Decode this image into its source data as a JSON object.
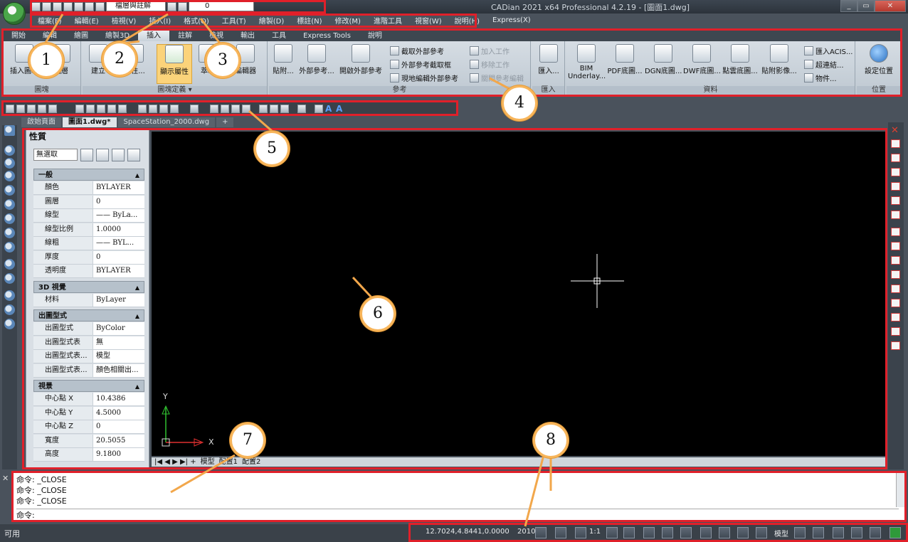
{
  "window": {
    "title": "CADian 2021 x64 Professional 4.2.19 - [圖面1.dwg]",
    "minimize": "_",
    "restore": "▭",
    "close": "✕"
  },
  "qat": {
    "layer_combo": "檔層與註解",
    "layer_value": "0"
  },
  "menu": [
    "檔案(F)",
    "編輯(E)",
    "檢視(V)",
    "插入(I)",
    "格式(O)",
    "工具(T)",
    "繪製(D)",
    "標註(N)",
    "修改(M)",
    "進階工具",
    "視窗(W)",
    "說明(H)",
    "Express(X)"
  ],
  "ribbon_tabs": [
    "開始",
    "編輯",
    "繪圖",
    "繪製3D",
    "插入",
    "註解",
    "檢視",
    "輸出",
    "工具",
    "Express Tools",
    "說明"
  ],
  "ribbon_active_tab": "插入",
  "panels": {
    "block": {
      "title": "圖塊",
      "buttons": [
        "插入圖塊",
        "圖層"
      ]
    },
    "block_def": {
      "title": "圖塊定義 ▾",
      "buttons": [
        "建立",
        "屬性...",
        "顯示屬性",
        "萃取",
        "編輯器"
      ]
    },
    "reference": {
      "title": "參考",
      "buttons": [
        "貼附...",
        "外部參考...",
        "開啟外部參考"
      ],
      "small": [
        "截取外部參考",
        "外部參考截取框",
        "現地編輯外部參考"
      ],
      "small_dim": [
        "加入工作",
        "移除工作",
        "關閉參考編輯"
      ]
    },
    "import": {
      "title": "匯入",
      "buttons": [
        "匯入..."
      ]
    },
    "data": {
      "title": "資料",
      "buttons": [
        "BIM Underlay...",
        "PDF底圖...",
        "DGN底圖...",
        "DWF底圖...",
        "點雲底圖...",
        "貼附影像..."
      ],
      "small": [
        "匯入ACIS...",
        "超連結...",
        "物件..."
      ]
    },
    "location": {
      "title": "位置",
      "buttons": [
        "設定位置"
      ]
    }
  },
  "doc_tabs": [
    "啟始頁面",
    "圖面1.dwg*",
    "SpaceStation_2000.dwg",
    "+"
  ],
  "properties": {
    "title": "性質",
    "selection": "無選取",
    "sections": [
      {
        "name": "一般",
        "rows": [
          [
            "顏色",
            "BYLAYER"
          ],
          [
            "圖層",
            "0"
          ],
          [
            "線型",
            "—— ByLa..."
          ],
          [
            "線型比例",
            "1.0000"
          ],
          [
            "線粗",
            "—— BYL..."
          ],
          [
            "厚度",
            "0"
          ],
          [
            "透明度",
            "BYLAYER"
          ]
        ]
      },
      {
        "name": "3D 視覺",
        "rows": [
          [
            "材料",
            "ByLayer"
          ]
        ]
      },
      {
        "name": "出圖型式",
        "rows": [
          [
            "出圖型式",
            "ByColor"
          ],
          [
            "出圖型式表",
            "無"
          ],
          [
            "出圖型式表...",
            "模型"
          ],
          [
            "出圖型式表...",
            "顏色相關出..."
          ]
        ]
      },
      {
        "name": "視景",
        "rows": [
          [
            "中心點 X",
            "10.4386"
          ],
          [
            "中心點 Y",
            "4.5000"
          ],
          [
            "中心點 Z",
            "0"
          ],
          [
            "寬度",
            "20.5055"
          ],
          [
            "高度",
            "9.1800"
          ]
        ]
      }
    ]
  },
  "axes": {
    "x": "X",
    "y": "Y"
  },
  "layout_tabs": [
    "模型",
    "配置1",
    "配置2"
  ],
  "command_history": [
    "命令: _CLOSE",
    "命令: _CLOSE",
    "命令: _CLOSE"
  ],
  "command_prompt": "命令:",
  "status": {
    "ready": "可用",
    "coords": "12.7024,4.8441,0.0000",
    "year": "2010",
    "scale": "1:1",
    "model": "模型"
  },
  "callouts": [
    "1",
    "2",
    "3",
    "4",
    "5",
    "6",
    "7",
    "8"
  ],
  "colors": {
    "highlight": "#e0202a",
    "callout_border": "#f7b55b"
  }
}
